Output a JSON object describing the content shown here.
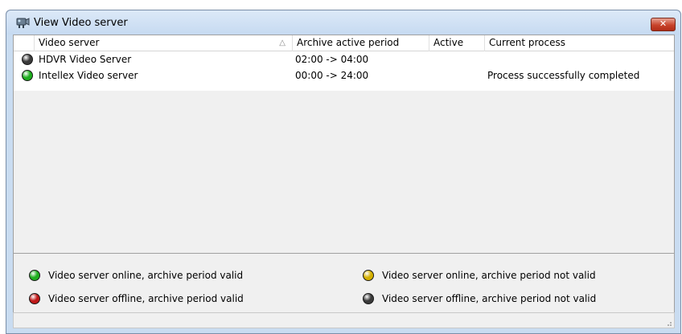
{
  "window": {
    "title": "View Video server",
    "close_label": "✕"
  },
  "table": {
    "columns": [
      {
        "label": "Video server",
        "sort_indicator": "△"
      },
      {
        "label": "Archive active period"
      },
      {
        "label": "Active"
      },
      {
        "label": "Current process"
      }
    ],
    "rows": [
      {
        "status": "offline",
        "status_color": "#3a3a3a",
        "name": "HDVR Video Server",
        "period": "02:00 -> 04:00",
        "active": "",
        "process": ""
      },
      {
        "status": "online",
        "status_color": "#1fae1f",
        "name": "Intellex Video server",
        "period": "00:00 -> 24:00",
        "active": "",
        "process": "Process successfully completed"
      }
    ]
  },
  "legend": [
    {
      "icon": "green-status-icon",
      "color": "#1fae1f",
      "text": "Video server online, archive period valid"
    },
    {
      "icon": "red-status-icon",
      "color": "#c01818",
      "text": "Video server offline, archive period valid"
    },
    {
      "icon": "yellow-status-icon",
      "color": "#d4b000",
      "text": "Video server online, archive period not valid"
    },
    {
      "icon": "gray-status-icon",
      "color": "#3a3a3a",
      "text": "Video server offline, archive period not valid"
    }
  ]
}
